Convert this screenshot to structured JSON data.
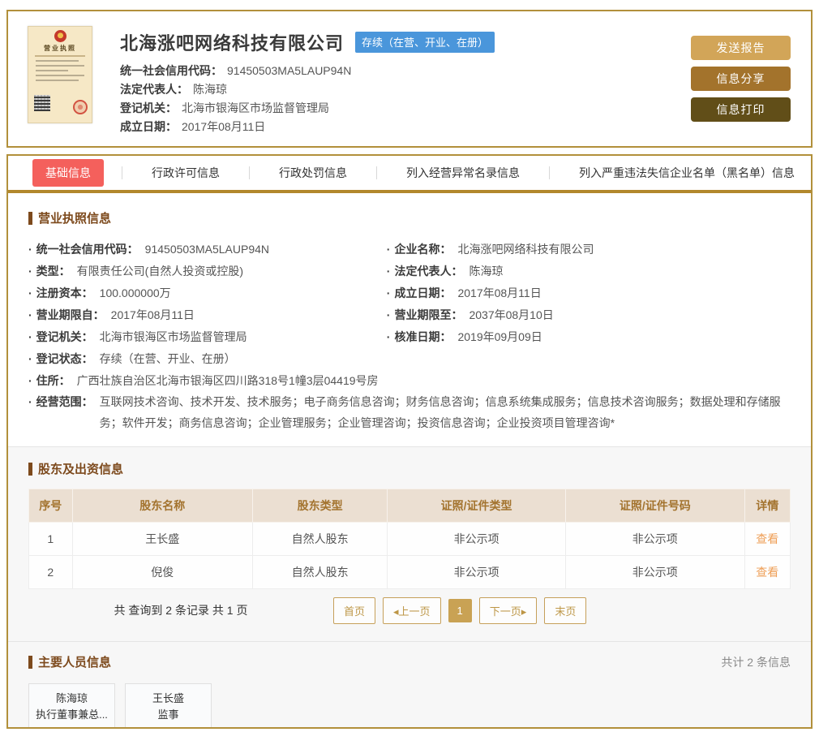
{
  "ui": {
    "bullet": "·"
  },
  "header": {
    "company_name": "北海涨吧网络科技有限公司",
    "status_badge": "存续（在营、开业、在册）",
    "license_title": "营业执照",
    "fields": [
      {
        "label": "统一社会信用代码：",
        "value": "91450503MA5LAUP94N"
      },
      {
        "label": "法定代表人：",
        "value": "陈海琼"
      },
      {
        "label": "登记机关：",
        "value": "北海市银海区市场监督管理局"
      },
      {
        "label": "成立日期：",
        "value": "2017年08月11日"
      }
    ],
    "actions": {
      "send_report": "发送报告",
      "share_info": "信息分享",
      "print_info": "信息打印"
    }
  },
  "tabs": [
    {
      "label": "基础信息",
      "active": true
    },
    {
      "label": "行政许可信息",
      "active": false
    },
    {
      "label": "行政处罚信息",
      "active": false
    },
    {
      "label": "列入经营异常名录信息",
      "active": false
    },
    {
      "label": "列入严重违法失信企业名单（黑名单）信息",
      "active": false
    }
  ],
  "license_section": {
    "title": "营业执照信息",
    "left_fields": [
      {
        "label": "统一社会信用代码：",
        "value": "91450503MA5LAUP94N"
      },
      {
        "label": "类型：",
        "value": "有限责任公司(自然人投资或控股)"
      },
      {
        "label": "注册资本：",
        "value": "100.000000万"
      },
      {
        "label": "营业期限自：",
        "value": "2017年08月11日"
      },
      {
        "label": "登记机关：",
        "value": "北海市银海区市场监督管理局"
      },
      {
        "label": "登记状态：",
        "value": "存续（在营、开业、在册）"
      }
    ],
    "right_fields": [
      {
        "label": "企业名称：",
        "value": "北海涨吧网络科技有限公司"
      },
      {
        "label": "法定代表人：",
        "value": "陈海琼"
      },
      {
        "label": "成立日期：",
        "value": "2017年08月11日"
      },
      {
        "label": "营业期限至：",
        "value": "2037年08月10日"
      },
      {
        "label": "核准日期：",
        "value": "2019年09月09日"
      }
    ],
    "full_fields": [
      {
        "label": "住所：",
        "value": "广西壮族自治区北海市银海区四川路318号1幢3层04419号房"
      },
      {
        "label": "经营范围：",
        "value": "互联网技术咨询、技术开发、技术服务；电子商务信息咨询；财务信息咨询；信息系统集成服务；信息技术咨询服务；数据处理和存储服务；软件开发；商务信息咨询；企业管理服务；企业管理咨询；投资信息咨询；企业投资项目管理咨询*"
      }
    ]
  },
  "shareholders_section": {
    "title": "股东及出资信息",
    "headers": [
      "序号",
      "股东名称",
      "股东类型",
      "证照/证件类型",
      "证照/证件号码",
      "详情"
    ],
    "rows": [
      {
        "no": "1",
        "name": "王长盛",
        "type": "自然人股东",
        "cert_type": "非公示项",
        "cert_no": "非公示项",
        "detail": "查看"
      },
      {
        "no": "2",
        "name": "倪俊",
        "type": "自然人股东",
        "cert_type": "非公示项",
        "cert_no": "非公示项",
        "detail": "查看"
      }
    ],
    "summary": "共 查询到 2 条记录 共 1 页",
    "pagination": {
      "first": "首页",
      "prev": "◂上一页",
      "page": "1",
      "next": "下一页▸",
      "last": "末页"
    }
  },
  "personnel_section": {
    "title": "主要人员信息",
    "count": "共计 2 条信息",
    "people": [
      {
        "name": "陈海琼",
        "role": "执行董事兼总..."
      },
      {
        "name": "王长盛",
        "role": "监事"
      }
    ]
  },
  "colors": {
    "gold_border": "#b2903b",
    "active_tab_red": "#f4605c",
    "status_blue": "#4a96db",
    "btn_report": "#d2a558",
    "btn_share": "#a3732c",
    "btn_print": "#614e18",
    "table_header_bg": "#ebdfd2",
    "view_link_orange": "#ef9f57"
  }
}
